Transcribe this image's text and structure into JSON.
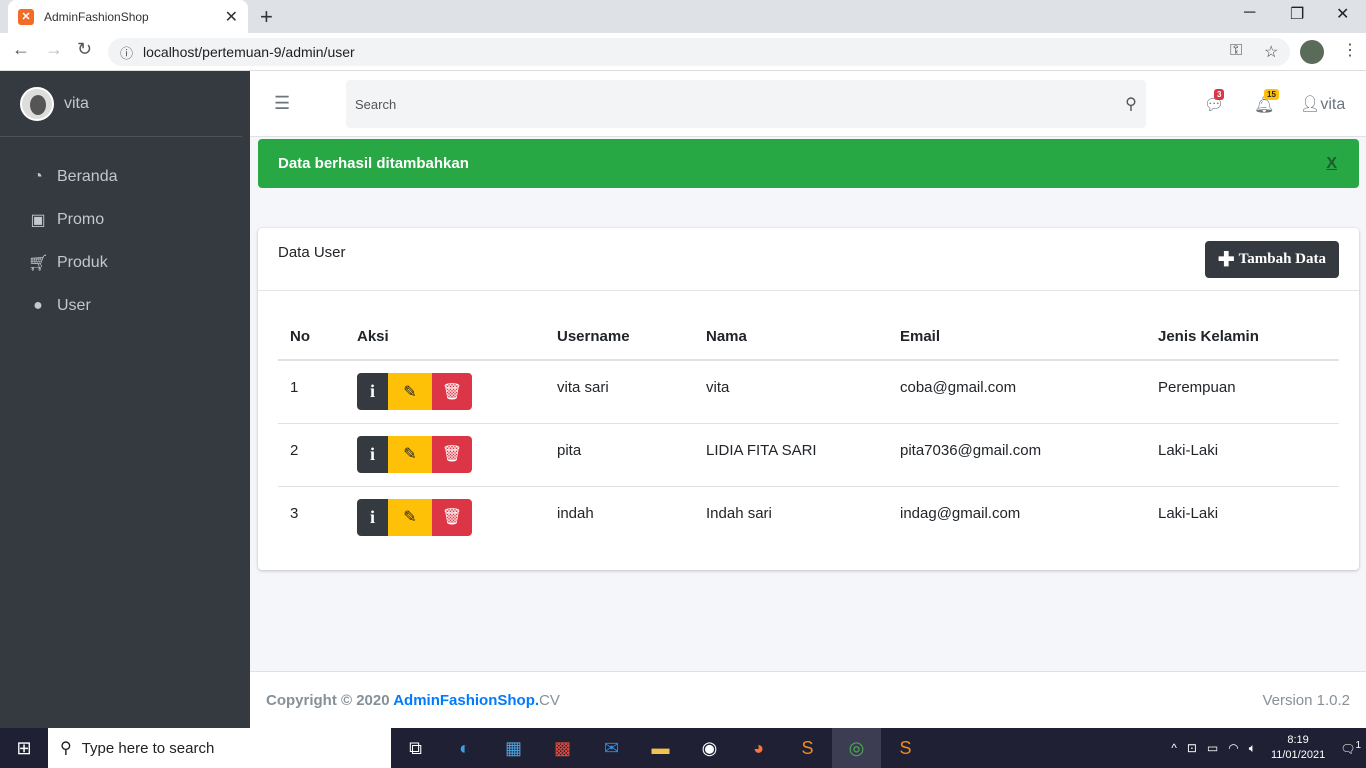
{
  "browser": {
    "tab_title": "AdminFashionShop",
    "url": "localhost/pertemuan-9/admin/user"
  },
  "sidebar": {
    "user": "vita",
    "items": [
      {
        "label": "Beranda",
        "icon": "tachometer-icon"
      },
      {
        "label": "Promo",
        "icon": "shopping-bag-icon"
      },
      {
        "label": "Produk",
        "icon": "shopping-cart-icon"
      },
      {
        "label": "User",
        "icon": "user-icon"
      }
    ]
  },
  "topnav": {
    "search_placeholder": "Search",
    "messages_count": "3",
    "notifications_count": "15",
    "user": "vita"
  },
  "alert": {
    "message": "Data berhasil ditambahkan",
    "close": "X"
  },
  "card": {
    "title": "Data User",
    "add_button": "Tambah Data"
  },
  "table": {
    "headers": [
      "No",
      "Aksi",
      "Username",
      "Nama",
      "Email",
      "Jenis Kelamin"
    ],
    "rows": [
      {
        "no": "1",
        "username": "vita sari",
        "nama": "vita",
        "email": "coba@gmail.com",
        "gender": "Perempuan"
      },
      {
        "no": "2",
        "username": "pita",
        "nama": "LIDIA FITA SARI",
        "email": "pita7036@gmail.com",
        "gender": "Laki-Laki"
      },
      {
        "no": "3",
        "username": "indah",
        "nama": "Indah sari",
        "email": "indag@gmail.com",
        "gender": "Laki-Laki"
      }
    ]
  },
  "footer": {
    "copyright": "Copyright © 2020 ",
    "brand": "AdminFashionShop.",
    "suffix": "CV",
    "version": "Version 1.0.2"
  },
  "taskbar": {
    "search_text": "Type here to search",
    "time": "8:19",
    "date": "11/01/2021",
    "notification_count": "1"
  },
  "colors": {
    "sidebar_bg": "#343a40",
    "alert_success": "#28a745",
    "btn_warning": "#ffc107",
    "btn_danger": "#dc3545",
    "brand_blue": "#007bff"
  }
}
